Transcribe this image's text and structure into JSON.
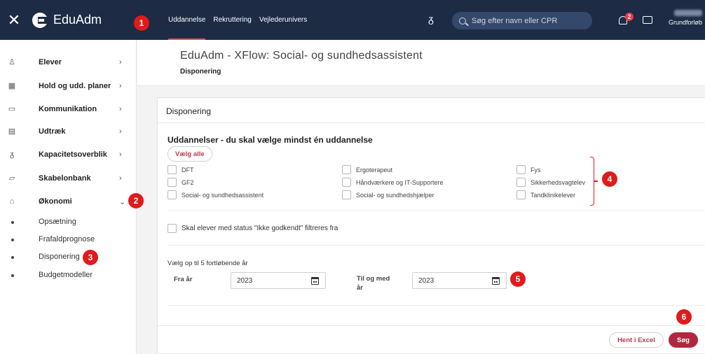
{
  "app": {
    "close_label": "✕",
    "name": "EduAdm"
  },
  "topnav": [
    {
      "label": "Uddannelse",
      "active": true
    },
    {
      "label": "Rekruttering",
      "active": false
    },
    {
      "label": "Vejlederunivers",
      "active": false
    }
  ],
  "search": {
    "placeholder": "Søg efter navn eller CPR"
  },
  "notifications": {
    "badge": "2"
  },
  "user": {
    "label": "Grundforløb"
  },
  "sidebar": {
    "items": [
      {
        "label": "Elever",
        "icon": "person-icon",
        "chevron": "›"
      },
      {
        "label": "Hold og udd. planer",
        "icon": "calendar-icon",
        "chevron": "›"
      },
      {
        "label": "Kommunikation",
        "icon": "chat-icon",
        "chevron": "›"
      },
      {
        "label": "Udtræk",
        "icon": "document-icon",
        "chevron": "›"
      },
      {
        "label": "Kapacitetsoverblik",
        "icon": "capacity-icon",
        "chevron": "›"
      },
      {
        "label": "Skabelonbank",
        "icon": "template-icon",
        "chevron": "›"
      },
      {
        "label": "Økonomi",
        "icon": "bag-icon",
        "chevron": "⌄"
      }
    ],
    "subitems": [
      {
        "label": "Opsætning"
      },
      {
        "label": "Frafaldprognose"
      },
      {
        "label": "Disponering"
      },
      {
        "label": "Budgetmodeller"
      }
    ]
  },
  "header": {
    "title": "EduAdm - XFlow: Social- og sundhedsassistent",
    "subtitle": "Disponering"
  },
  "card": {
    "title": "Disponering",
    "section_title": "Uddannelser - du skal vælge mindst én uddannelse",
    "select_all": "Vælg alle",
    "educations": [
      [
        "DFT",
        "Ergoterapeut",
        "Fys"
      ],
      [
        "GF2",
        "Håndværkere og IT-Supportere",
        "Sikkerhedsvagtelev"
      ],
      [
        "Social- og sundhedsassistent",
        "Social- og sundhedshjælper",
        "Tandklinikelever"
      ]
    ],
    "filter_label": "Skal elever med status \"Ikke godkendt\" filtreres fra",
    "year_title": "Vælg op til 5 fortløbende år",
    "from_label": "Fra år",
    "from_value": "2023",
    "to_label_1": "Til og med",
    "to_label_2": "år",
    "to_value": "2023",
    "excel_label": "Hent i Excel",
    "search_label": "Søg"
  },
  "markers": [
    "1",
    "2",
    "3",
    "4",
    "5",
    "6"
  ],
  "colors": {
    "topbar": "#1d2b44",
    "accent": "#b0283f",
    "marker": "#e01b1b"
  }
}
